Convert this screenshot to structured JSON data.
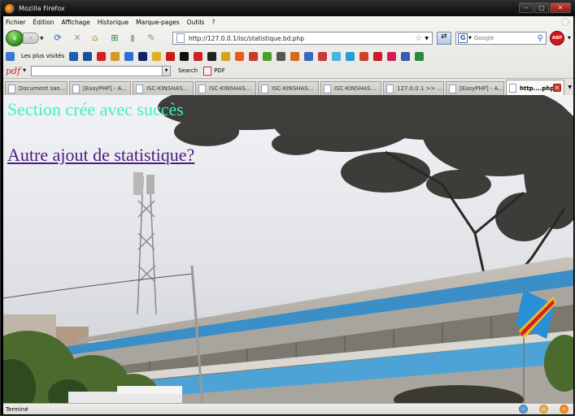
{
  "window": {
    "title": "Mozilla Firefox"
  },
  "menu": [
    "Fichier",
    "Édition",
    "Affichage",
    "Historique",
    "Marque-pages",
    "Outils",
    "?"
  ],
  "navbar": {
    "url": "http://127.0.0.1/isc/statistique.bd.php",
    "search_placeholder": "Google",
    "search_engine_letter": "G",
    "abp_label": "ABP"
  },
  "bookmarks": {
    "most_visited_label": "Les plus visités",
    "icon_colors": [
      "#1c5fb5",
      "#1a4fa0",
      "#d21f1f",
      "#d9992a",
      "#2a6dd4",
      "#112266",
      "#e0b020",
      "#c91a1a",
      "#111111",
      "#ce2020",
      "#222222",
      "#d7a21b",
      "#e85a20",
      "#c83a2a",
      "#4aa02a",
      "#555555",
      "#d46a1a",
      "#3a6ac0",
      "#c93a3a",
      "#4ab3e0",
      "#2a9ad0",
      "#d0402a",
      "#c81a2a",
      "#d61a5a",
      "#3a5ab0",
      "#2a8a3a"
    ]
  },
  "pdfbar": {
    "logo": "pdf",
    "search_label": "Search",
    "pdf_button_label": "PDF"
  },
  "tabs": [
    {
      "label": "Document san..."
    },
    {
      "label": "[EasyPHP] - A..."
    },
    {
      "label": "ISC-KINSHAS..."
    },
    {
      "label": "ISC-KINSHAS..."
    },
    {
      "label": "ISC-KINSHAS..."
    },
    {
      "label": "ISC-KINSHAS..."
    },
    {
      "label": "127.0.0.1 >> ..."
    },
    {
      "label": "[EasyPHP] - A..."
    },
    {
      "label": "http....php"
    }
  ],
  "content": {
    "message": "Section crée avec succès",
    "link_text": "Autre ajout de statistique?"
  },
  "status": {
    "text": "Terminé"
  }
}
